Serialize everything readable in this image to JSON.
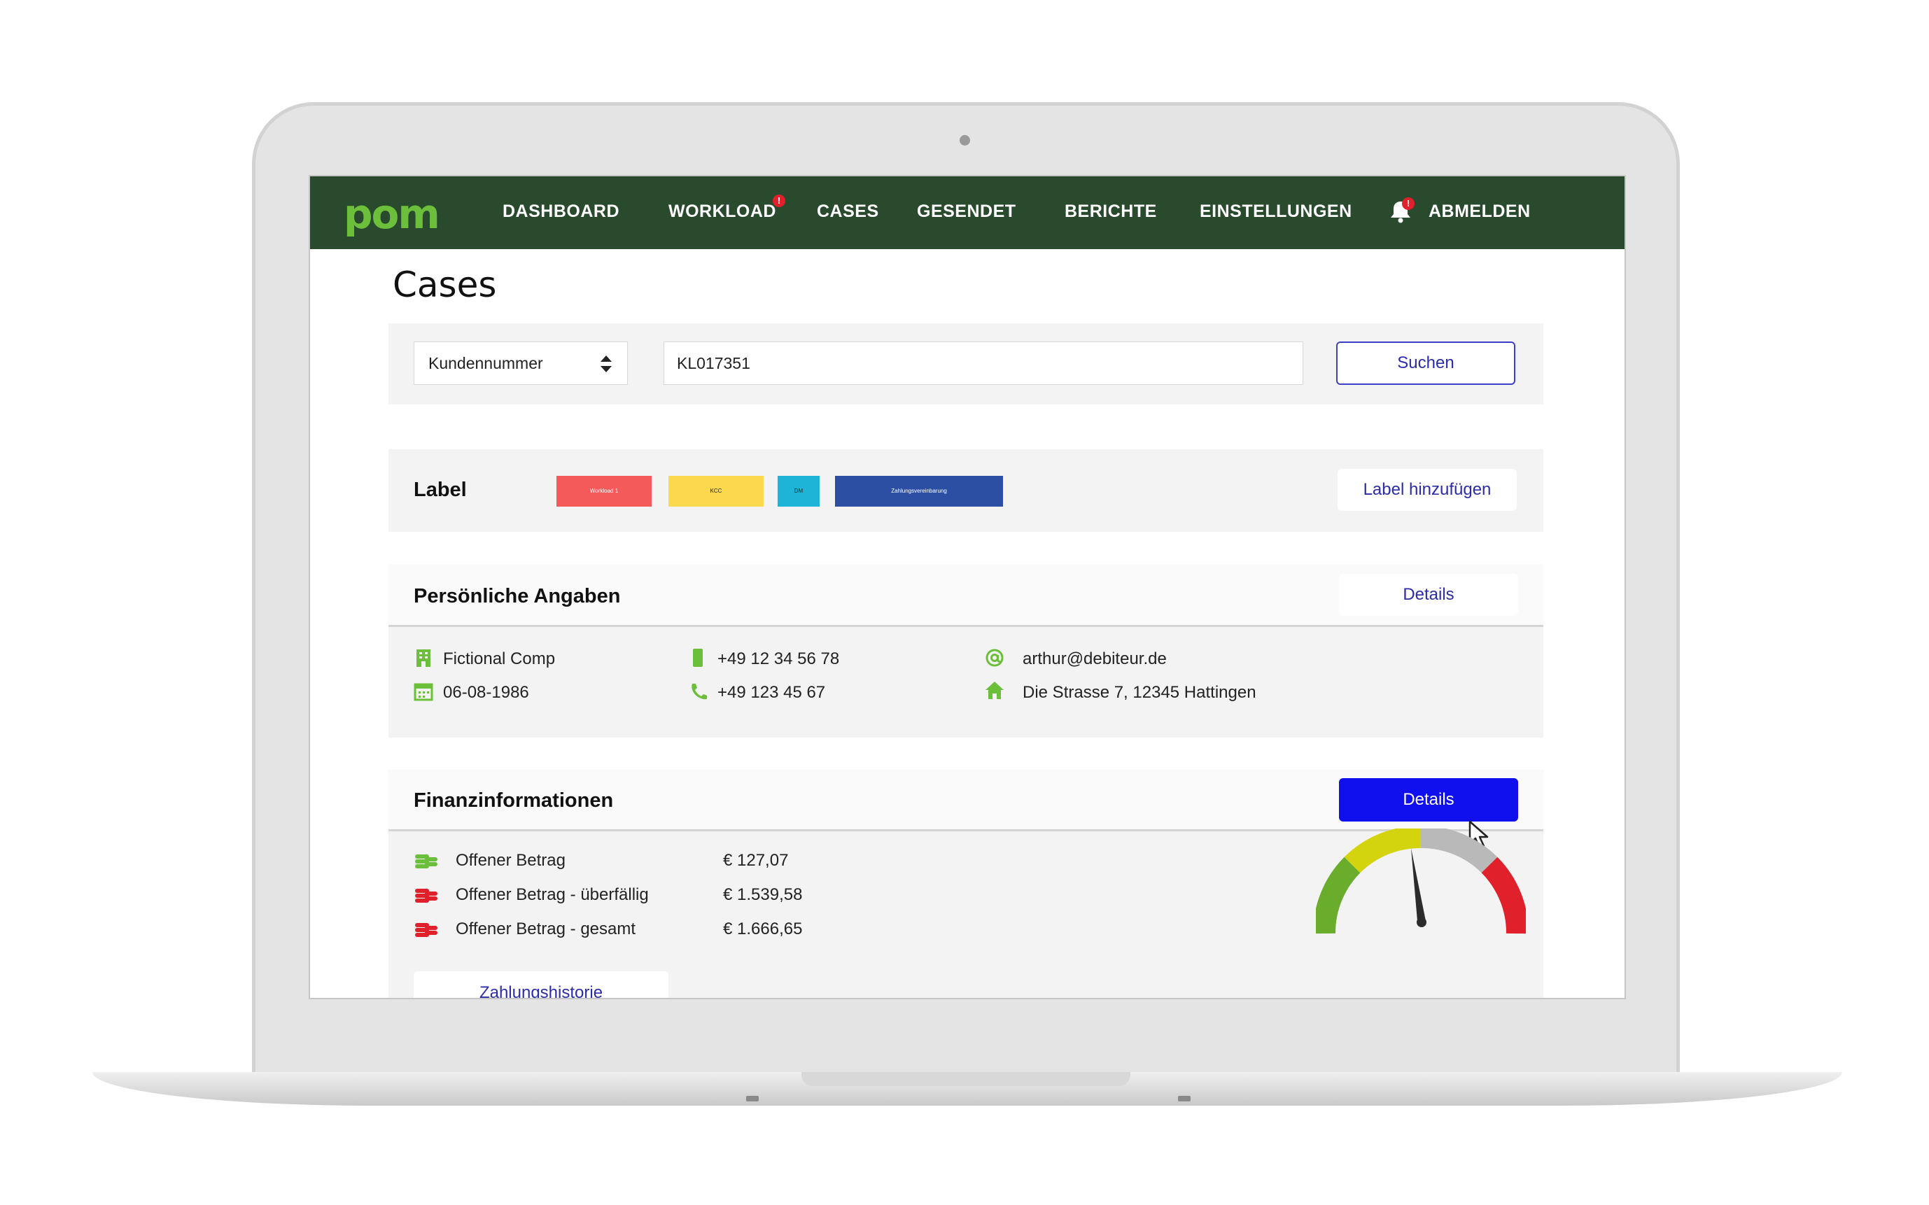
{
  "nav": {
    "logo": "pom",
    "items": [
      "DASHBOARD",
      "WORKLOAD",
      "CASES",
      "GESENDET",
      "BERICHTE",
      "EINSTELLUNGEN",
      "ABMELDEN"
    ],
    "workload_badge": "!",
    "bell_badge": "!"
  },
  "page": {
    "title": "Cases"
  },
  "search": {
    "select_value": "Kundennummer",
    "input_value": "KL017351",
    "button": "Suchen"
  },
  "labels": {
    "heading": "Label",
    "chips": [
      {
        "text": "Workload 1",
        "color": "#f55a5a"
      },
      {
        "text": "KCC",
        "color": "#fbd84e"
      },
      {
        "text": "DM",
        "color": "#1eb4d8"
      },
      {
        "text": "Zahlungsvereinbarung",
        "color": "#2d4fa3"
      }
    ],
    "add_button": "Label hinzufügen"
  },
  "personal": {
    "heading": "Persönliche Angaben",
    "details_button": "Details",
    "company": "Fictional Comp",
    "birthdate": "06-08-1986",
    "mobile": "+49 12 34 56 78",
    "phone": "+49 123 45 67",
    "email": "arthur@debiteur.de",
    "address": "Die Strasse 7, 12345 Hattingen"
  },
  "finance": {
    "heading": "Finanzinformationen",
    "details_button": "Details",
    "rows": [
      {
        "label": "Offener Betrag",
        "value": "€ 127,07",
        "icon_color": "#6cbf3a"
      },
      {
        "label": "Offener Betrag - überfällig",
        "value": "€ 1.539,58",
        "icon_color": "#e0202a"
      },
      {
        "label": "Offener Betrag - gesamt",
        "value": "€ 1.666,65",
        "icon_color": "#e0202a"
      }
    ],
    "history_button": "Zahlungshistorie"
  },
  "colors": {
    "nav_bg": "#2a4a2d",
    "brand_green": "#6cbf3a",
    "accent_blue": "#1010ee",
    "link_blue": "#2c2ca8"
  }
}
